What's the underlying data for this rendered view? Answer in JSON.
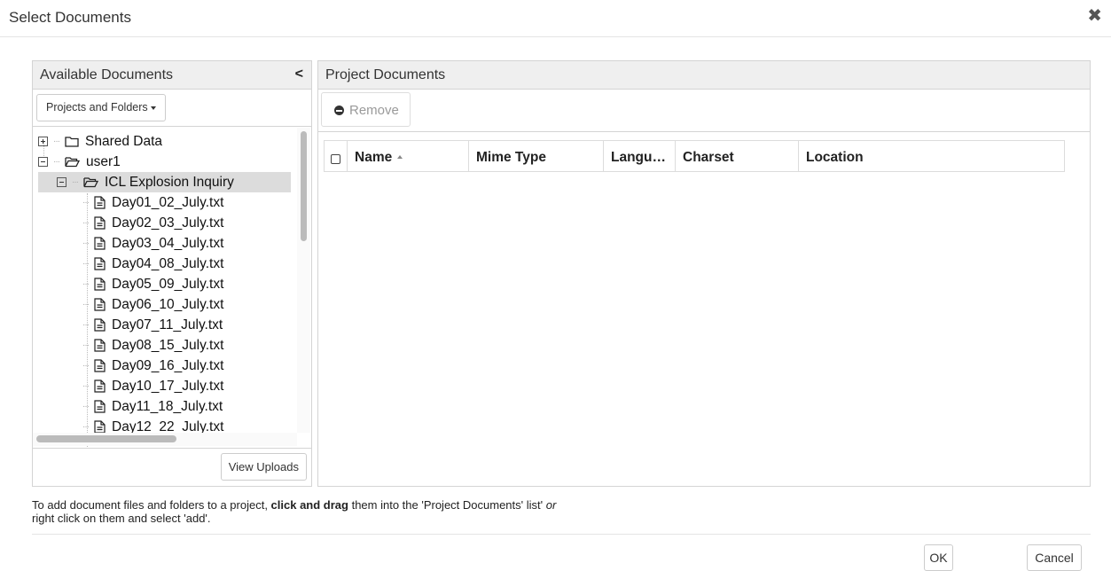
{
  "dialog": {
    "title": "Select Documents",
    "close_glyph": "✖"
  },
  "left_panel": {
    "title": "Available Documents",
    "collapse_glyph": "<",
    "dropdown_label": "Projects and Folders",
    "view_uploads_label": "View Uploads",
    "tree": {
      "shared": "Shared Data",
      "user": "user1",
      "project": "ICL Explosion Inquiry",
      "files": [
        "Day01_02_July.txt",
        "Day02_03_July.txt",
        "Day03_04_July.txt",
        "Day04_08_July.txt",
        "Day05_09_July.txt",
        "Day06_10_July.txt",
        "Day07_11_July.txt",
        "Day08_15_July.txt",
        "Day09_16_July.txt",
        "Day10_17_July.txt",
        "Day11_18_July.txt",
        "Day12_22_July.txt"
      ]
    }
  },
  "right_panel": {
    "title": "Project Documents",
    "remove_label": "Remove",
    "columns": [
      "Name",
      "Mime Type",
      "Langu…",
      "Charset",
      "Location"
    ]
  },
  "footer": {
    "help_part1": "To add document files and folders to a project, ",
    "help_bold": "click and drag",
    "help_part2": " them into the 'Project Documents' list' ",
    "help_italic": "or",
    "help_line2": "right click on them and select 'add'.",
    "ok_label": "OK",
    "cancel_label": "Cancel"
  }
}
